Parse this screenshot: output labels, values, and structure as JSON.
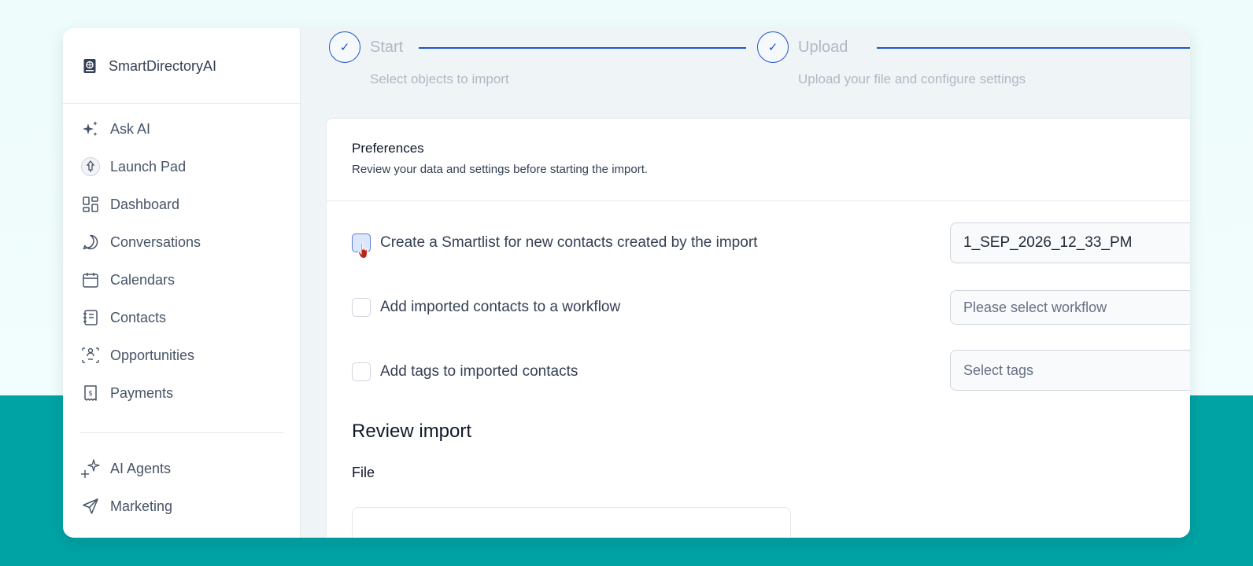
{
  "brand": {
    "name": "SmartDirectoryAI",
    "icon": "book-icon"
  },
  "sidebar": {
    "items": [
      {
        "label": "Ask AI",
        "icon": "sparkles-icon"
      },
      {
        "label": "Launch Pad",
        "icon": "rocket-icon"
      },
      {
        "label": "Dashboard",
        "icon": "dashboard-grid-icon"
      },
      {
        "label": "Conversations",
        "icon": "chat-bubble-icon"
      },
      {
        "label": "Calendars",
        "icon": "calendar-icon"
      },
      {
        "label": "Contacts",
        "icon": "contacts-book-icon"
      },
      {
        "label": "Opportunities",
        "icon": "opportunities-icon"
      },
      {
        "label": "Payments",
        "icon": "payments-receipt-icon"
      },
      {
        "label": "AI Agents",
        "icon": "ai-agents-sparkle-icon"
      },
      {
        "label": "Marketing",
        "icon": "paper-plane-icon"
      }
    ]
  },
  "steps": [
    {
      "title": "Start",
      "subtitle": "Select objects to import",
      "status": "complete"
    },
    {
      "title": "Upload",
      "subtitle": "Upload your file and configure settings",
      "status": "complete"
    }
  ],
  "preferences": {
    "title": "Preferences",
    "subtitle": "Review your data and settings before starting the import.",
    "options": [
      {
        "label": "Create a Smartlist for new contacts created by the import",
        "checked": false,
        "field_value": "1_SEP_2026_12_33_PM"
      },
      {
        "label": "Add imported contacts to a workflow",
        "checked": false,
        "field_placeholder": "Please select workflow"
      },
      {
        "label": "Add tags to imported contacts",
        "checked": false,
        "field_placeholder": "Select tags"
      }
    ]
  },
  "review": {
    "title": "Review import",
    "file_label": "File"
  },
  "colors": {
    "accent": "#1e55c8",
    "teal_background": "#00a3a4",
    "cursor": "#b8261a"
  }
}
